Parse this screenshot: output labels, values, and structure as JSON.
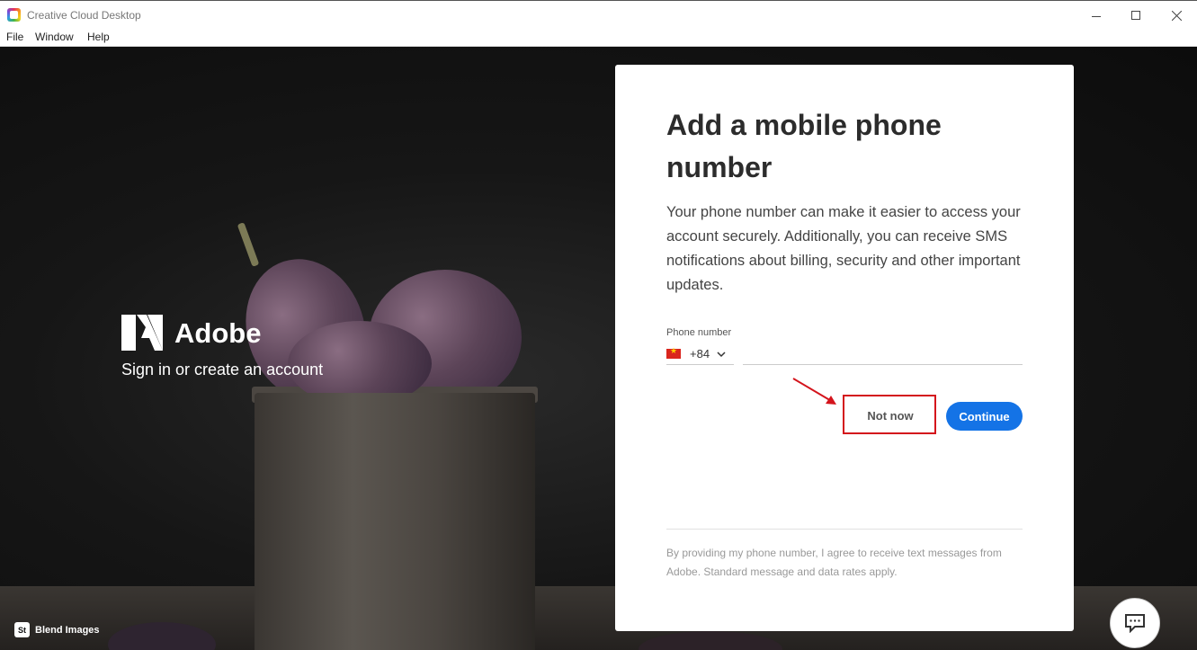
{
  "window": {
    "title": "Creative Cloud Desktop",
    "controls": [
      "minimize-icon",
      "maximize-icon",
      "close-icon"
    ]
  },
  "menu": {
    "items": [
      "File",
      "Window",
      "Help"
    ]
  },
  "brand": {
    "name": "Adobe",
    "tagline": "Sign in or create an account",
    "stock_badge": "St",
    "stock_credit": "Blend Images"
  },
  "dialog": {
    "title": "Add a mobile phone number",
    "description": "Your phone number can make it easier to access your account securely. Additionally, you can receive SMS notifications about billing, security and other important updates.",
    "phone_label": "Phone number",
    "country_flag": "vietnam-flag-icon",
    "country_code": "+84",
    "phone_value": "",
    "not_now_label": "Not now",
    "continue_label": "Continue",
    "legal_text": "By providing my phone number, I agree to receive text messages from Adobe. Standard message and data rates apply."
  },
  "annotation": {
    "highlight_color": "#d4141c"
  },
  "colors": {
    "primary_button": "#1473e6",
    "title_text": "#2c2c2c"
  }
}
